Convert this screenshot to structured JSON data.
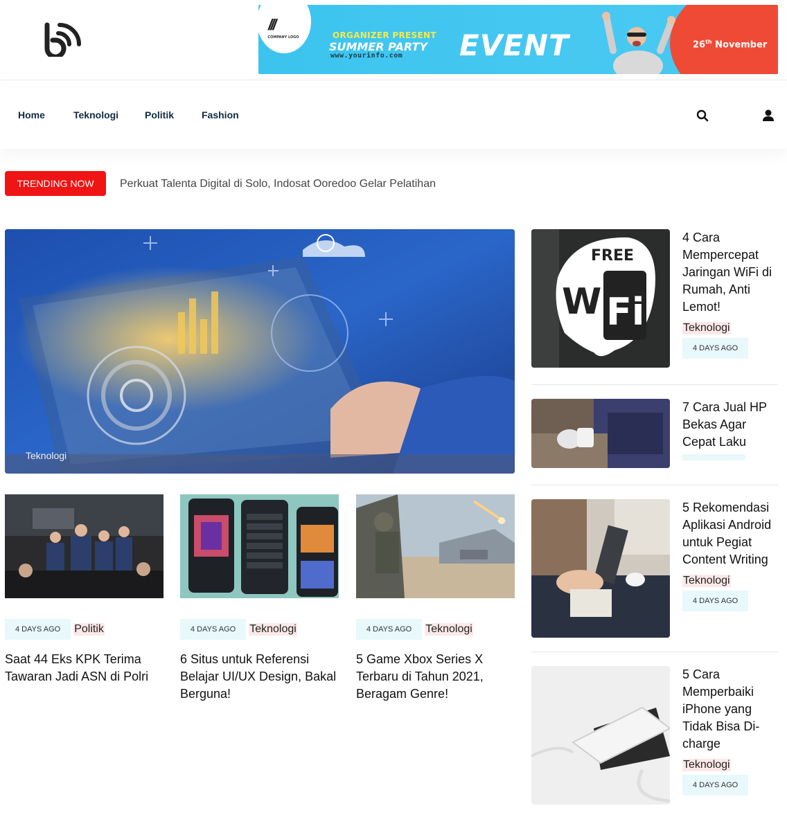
{
  "banner": {
    "logo_mark": "///",
    "logo_text": "COMPANY LOGO",
    "organizer": "ORGANIZER PRESENT",
    "summer": "SUMMER PARTY",
    "url": "www.yourinfo.com",
    "event": "EVENT",
    "date_day": "26",
    "date_sup": "th",
    "date_month": " November"
  },
  "nav": {
    "items": [
      {
        "label": "Home"
      },
      {
        "label": "Teknologi"
      },
      {
        "label": "Politik"
      },
      {
        "label": "Fashion"
      }
    ]
  },
  "trending": {
    "label": "TRENDING NOW",
    "headline": "Perkuat Talenta Digital di Solo, Indosat Ooredoo Gelar Pelatihan"
  },
  "hero": {
    "category": "Teknologi"
  },
  "cards": [
    {
      "time": "4 DAYS AGO",
      "category": "Politik",
      "title": "Saat 44 Eks KPK Terima Tawaran Jadi ASN di Polri"
    },
    {
      "time": "4 DAYS AGO",
      "category": "Teknologi",
      "title": "6 Situs untuk Referensi Belajar UI/UX Design, Bakal Berguna!"
    },
    {
      "time": "4 DAYS AGO",
      "category": "Teknologi",
      "title": "5 Game Xbox Series X Terbaru di Tahun 2021, Beragam Genre!"
    }
  ],
  "sidebar": [
    {
      "title": "4 Cara Mempercepat Jaringan WiFi di Rumah, Anti Lemot!",
      "category": "Teknologi",
      "time": "4 DAYS AGO",
      "image_text_1": "FREE",
      "image_text_2": "Wi",
      "image_text_3": "Fi"
    },
    {
      "title": "7 Cara Jual HP Bekas Agar Cepat Laku",
      "category": "",
      "time": ""
    },
    {
      "title": "5 Rekomendasi Aplikasi Android untuk Pegiat Content Writing",
      "category": "Teknologi",
      "time": "4 DAYS AGO"
    },
    {
      "title": "5 Cara Memperbaiki iPhone yang Tidak Bisa Di-charge",
      "category": "Teknologi",
      "time": "4 DAYS AGO"
    }
  ]
}
